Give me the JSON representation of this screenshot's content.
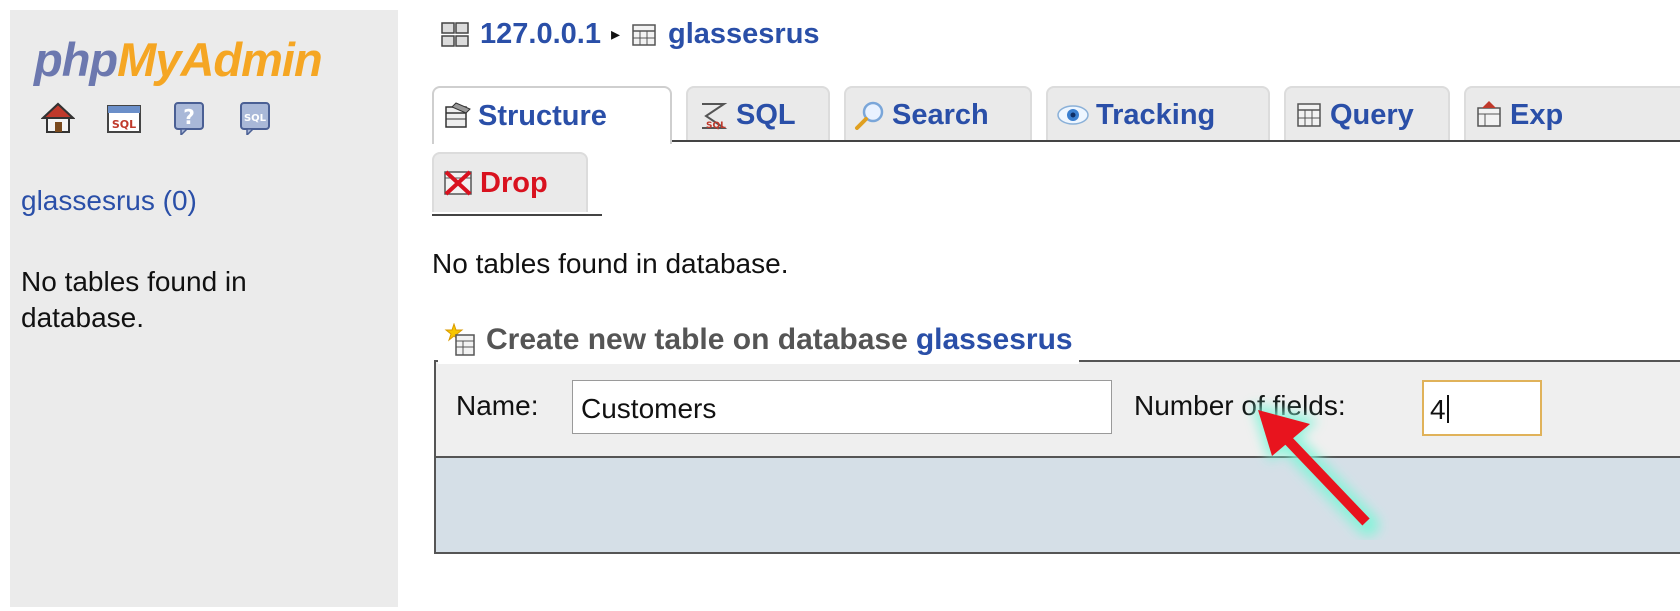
{
  "left_nav": {
    "logo": {
      "php": "php",
      "my": "My",
      "admin": "Admin"
    },
    "icons": [
      "home-icon",
      "sql-query-icon",
      "help-icon",
      "sql-docs-icon"
    ],
    "database_link": "glassesrus (0)",
    "no_tables_text": "No tables found in database."
  },
  "breadcrumb": {
    "server": "127.0.0.1",
    "separator": "▸",
    "database": "glassesrus"
  },
  "tabs": [
    {
      "label": "Structure",
      "icon": "structure-icon",
      "active": true
    },
    {
      "label": "SQL",
      "icon": "sql-icon",
      "active": false
    },
    {
      "label": "Search",
      "icon": "search-icon",
      "active": false
    },
    {
      "label": "Tracking",
      "icon": "tracking-eye-icon",
      "active": false
    },
    {
      "label": "Query",
      "icon": "query-icon",
      "active": false
    },
    {
      "label": "Exp",
      "icon": "export-icon",
      "active": false
    }
  ],
  "drop_tab": {
    "label": "Drop",
    "icon": "drop-icon"
  },
  "main": {
    "no_tables_text": "No tables found in database."
  },
  "create_table": {
    "legend_prefix": "Create new table on database",
    "legend_db": "glassesrus",
    "name_label": "Name:",
    "name_value": "Customers",
    "fields_label": "Number of fields:",
    "fields_value": "4"
  },
  "colors": {
    "link_blue": "#2a4fa8",
    "drop_red": "#d9121f",
    "arrow_red": "#e8141e",
    "arrow_glow": "#7ff5d8",
    "panel_gray": "#ebebeb",
    "fieldset_bottom": "#d5dfe7"
  }
}
